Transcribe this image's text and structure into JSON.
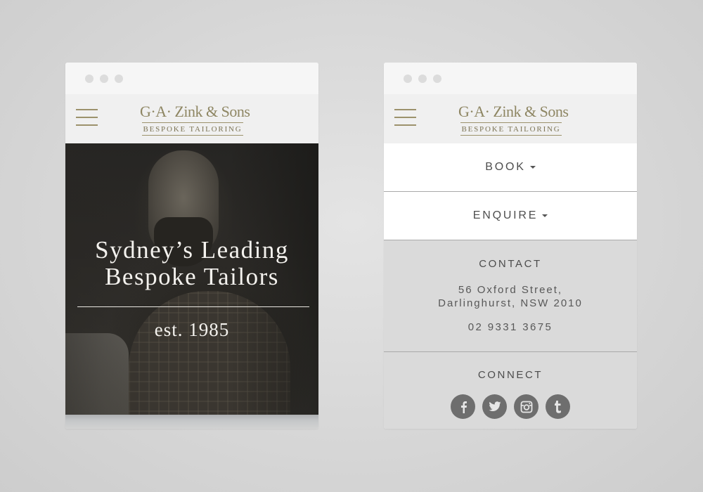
{
  "brand": {
    "name": "G·A· Zink & Sons",
    "tagline": "BESPOKE TAILORING",
    "gold": "#9c926c"
  },
  "left_screen": {
    "hero": {
      "title_line1": "Sydney’s Leading",
      "title_line2": "Bespoke Tailors",
      "est": "est. 1985"
    }
  },
  "right_screen": {
    "menu": [
      {
        "label": "BOOK",
        "icon": "caret-down-icon"
      },
      {
        "label": "ENQUIRE",
        "icon": "caret-down-icon"
      }
    ],
    "contact": {
      "heading": "CONTACT",
      "address_line1": "56 Oxford Street,",
      "address_line2": "Darlinghurst, NSW 2010",
      "phone": "02 9331 3675"
    },
    "connect": {
      "heading": "CONNECT",
      "icons": [
        "facebook-icon",
        "twitter-icon",
        "instagram-icon",
        "tumblr-icon"
      ]
    }
  }
}
